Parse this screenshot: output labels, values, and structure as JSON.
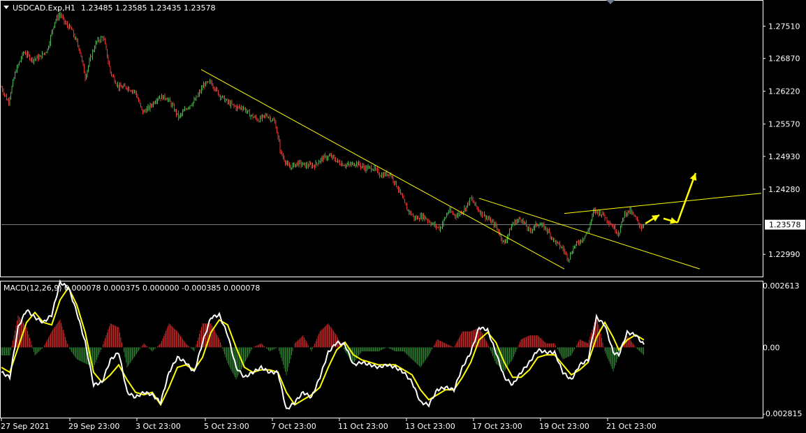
{
  "header": {
    "symbol": "USDCAD.Exp,H1",
    "ohlc": "1.23485 1.23585 1.23435 1.23578",
    "macd_label": "MACD(12,26,9)",
    "macd_values": "0.000078 0.000375 0.000000 -0.000385 0.000078"
  },
  "colors": {
    "background": "#000000",
    "frame": "#ffffff",
    "bull_candle": "#4caf50",
    "bear_candle": "#e53935",
    "trendline": "#ffff00",
    "annotation_arrow": "#ffff00",
    "macd_line": "#ffffff",
    "signal_line": "#ffff00",
    "hist_positive": "#c62828",
    "hist_negative": "#2e7d32",
    "price_line": "#b0bec5"
  },
  "current_price": "1.23578",
  "chart_data": [
    {
      "type": "candlestick",
      "title": "USDCAD.Exp,H1",
      "ylim": [
        1.2255,
        1.28
      ],
      "y_ticks": [
        "1.27510",
        "1.26870",
        "1.26220",
        "1.25570",
        "1.24930",
        "1.24280",
        "1.23578",
        "1.22990"
      ],
      "x_ticks": [
        "27 Sep 2021",
        "29 Sep 23:00",
        "3 Oct 23:00",
        "5 Oct 23:00",
        "7 Oct 23:00",
        "11 Oct 23:00",
        "13 Oct 23:00",
        "17 Oct 23:00",
        "19 Oct 23:00",
        "21 Oct 23:00"
      ],
      "price_path": [
        {
          "x": 0,
          "y": 1.263
        },
        {
          "x": 5,
          "y": 1.26
        },
        {
          "x": 10,
          "y": 1.266
        },
        {
          "x": 16,
          "y": 1.27
        },
        {
          "x": 22,
          "y": 1.2685
        },
        {
          "x": 28,
          "y": 1.269
        },
        {
          "x": 33,
          "y": 1.2705
        },
        {
          "x": 38,
          "y": 1.276
        },
        {
          "x": 42,
          "y": 1.2775
        },
        {
          "x": 46,
          "y": 1.2755
        },
        {
          "x": 50,
          "y": 1.2745
        },
        {
          "x": 56,
          "y": 1.2705
        },
        {
          "x": 60,
          "y": 1.265
        },
        {
          "x": 64,
          "y": 1.269
        },
        {
          "x": 68,
          "y": 1.272
        },
        {
          "x": 73,
          "y": 1.273
        },
        {
          "x": 78,
          "y": 1.266
        },
        {
          "x": 84,
          "y": 1.263
        },
        {
          "x": 90,
          "y": 1.263
        },
        {
          "x": 96,
          "y": 1.262
        },
        {
          "x": 101,
          "y": 1.258
        },
        {
          "x": 106,
          "y": 1.259
        },
        {
          "x": 112,
          "y": 1.261
        },
        {
          "x": 118,
          "y": 1.261
        },
        {
          "x": 122,
          "y": 1.2595
        },
        {
          "x": 127,
          "y": 1.257
        },
        {
          "x": 133,
          "y": 1.259
        },
        {
          "x": 139,
          "y": 1.2605
        },
        {
          "x": 145,
          "y": 1.2635
        },
        {
          "x": 150,
          "y": 1.264
        },
        {
          "x": 156,
          "y": 1.2615
        },
        {
          "x": 162,
          "y": 1.26
        },
        {
          "x": 168,
          "y": 1.259
        },
        {
          "x": 173,
          "y": 1.259
        },
        {
          "x": 178,
          "y": 1.2575
        },
        {
          "x": 184,
          "y": 1.2565
        },
        {
          "x": 190,
          "y": 1.2575
        },
        {
          "x": 196,
          "y": 1.256
        },
        {
          "x": 200,
          "y": 1.25
        },
        {
          "x": 206,
          "y": 1.247
        },
        {
          "x": 212,
          "y": 1.248
        },
        {
          "x": 218,
          "y": 1.2475
        },
        {
          "x": 224,
          "y": 1.2475
        },
        {
          "x": 230,
          "y": 1.249
        },
        {
          "x": 236,
          "y": 1.2493
        },
        {
          "x": 242,
          "y": 1.248
        },
        {
          "x": 248,
          "y": 1.2475
        },
        {
          "x": 254,
          "y": 1.248
        },
        {
          "x": 260,
          "y": 1.247
        },
        {
          "x": 266,
          "y": 1.247
        },
        {
          "x": 272,
          "y": 1.2455
        },
        {
          "x": 278,
          "y": 1.246
        },
        {
          "x": 284,
          "y": 1.243
        },
        {
          "x": 290,
          "y": 1.239
        },
        {
          "x": 296,
          "y": 1.237
        },
        {
          "x": 302,
          "y": 1.2375
        },
        {
          "x": 308,
          "y": 1.236
        },
        {
          "x": 314,
          "y": 1.235
        },
        {
          "x": 320,
          "y": 1.2385
        },
        {
          "x": 326,
          "y": 1.2375
        },
        {
          "x": 332,
          "y": 1.239
        },
        {
          "x": 336,
          "y": 1.241
        },
        {
          "x": 342,
          "y": 1.2385
        },
        {
          "x": 348,
          "y": 1.237
        },
        {
          "x": 354,
          "y": 1.2355
        },
        {
          "x": 360,
          "y": 1.232
        },
        {
          "x": 366,
          "y": 1.236
        },
        {
          "x": 372,
          "y": 1.237
        },
        {
          "x": 378,
          "y": 1.2345
        },
        {
          "x": 384,
          "y": 1.236
        },
        {
          "x": 390,
          "y": 1.235
        },
        {
          "x": 396,
          "y": 1.2325
        },
        {
          "x": 402,
          "y": 1.231
        },
        {
          "x": 406,
          "y": 1.229
        },
        {
          "x": 410,
          "y": 1.2315
        },
        {
          "x": 416,
          "y": 1.233
        },
        {
          "x": 420,
          "y": 1.2345
        },
        {
          "x": 424,
          "y": 1.2385
        },
        {
          "x": 430,
          "y": 1.238
        },
        {
          "x": 436,
          "y": 1.236
        },
        {
          "x": 442,
          "y": 1.234
        },
        {
          "x": 446,
          "y": 1.238
        },
        {
          "x": 450,
          "y": 1.2385
        },
        {
          "x": 454,
          "y": 1.237
        },
        {
          "x": 458,
          "y": 1.2352
        },
        {
          "x": 460,
          "y": 1.2358
        }
      ],
      "trendlines": [
        {
          "name": "main-downtrend",
          "x1": 143,
          "y1": 1.2665,
          "x2": 403,
          "y2": 1.227
        },
        {
          "name": "channel-lower",
          "x1": 342,
          "y1": 1.241,
          "x2": 500,
          "y2": 1.227
        },
        {
          "name": "channel-upper",
          "x1": 403,
          "y1": 1.238,
          "x2": 544,
          "y2": 1.242
        }
      ],
      "projection_arrows": [
        {
          "x1": 461,
          "y1": 1.236,
          "x2": 471,
          "y2": 1.2377
        },
        {
          "x1": 474,
          "y1": 1.237,
          "x2": 484,
          "y2": 1.2362
        },
        {
          "x1": 484,
          "y1": 1.2362,
          "x2": 497,
          "y2": 1.246
        }
      ]
    },
    {
      "type": "macd",
      "title": "MACD(12,26,9)",
      "ylim": [
        -0.002815,
        0.002613
      ],
      "y_ticks": [
        "0.002613",
        "0.00",
        "-0.002815"
      ],
      "macd_path": [
        {
          "x": 0,
          "y": -0.001
        },
        {
          "x": 6,
          "y": -0.0012
        },
        {
          "x": 12,
          "y": 0.0008
        },
        {
          "x": 18,
          "y": 0.0015
        },
        {
          "x": 24,
          "y": 0.0012
        },
        {
          "x": 30,
          "y": 0.001
        },
        {
          "x": 36,
          "y": 0.0013
        },
        {
          "x": 42,
          "y": 0.0026
        },
        {
          "x": 48,
          "y": 0.0024
        },
        {
          "x": 54,
          "y": 0.0014
        },
        {
          "x": 60,
          "y": 0.0002
        },
        {
          "x": 66,
          "y": -0.0015
        },
        {
          "x": 72,
          "y": -0.0014
        },
        {
          "x": 78,
          "y": -0.0005
        },
        {
          "x": 84,
          "y": -0.0002
        },
        {
          "x": 90,
          "y": -0.0018
        },
        {
          "x": 96,
          "y": -0.002
        },
        {
          "x": 102,
          "y": -0.0018
        },
        {
          "x": 108,
          "y": -0.0019
        },
        {
          "x": 114,
          "y": -0.0022
        },
        {
          "x": 120,
          "y": -0.001
        },
        {
          "x": 126,
          "y": -0.0004
        },
        {
          "x": 132,
          "y": -0.0006
        },
        {
          "x": 138,
          "y": -0.001
        },
        {
          "x": 144,
          "y": 0.0002
        },
        {
          "x": 150,
          "y": 0.0012
        },
        {
          "x": 156,
          "y": 0.0013
        },
        {
          "x": 162,
          "y": 0.0005
        },
        {
          "x": 168,
          "y": -0.0008
        },
        {
          "x": 174,
          "y": -0.0012
        },
        {
          "x": 180,
          "y": -0.001
        },
        {
          "x": 186,
          "y": -0.0008
        },
        {
          "x": 192,
          "y": -0.001
        },
        {
          "x": 198,
          "y": -0.001
        },
        {
          "x": 204,
          "y": -0.0025
        },
        {
          "x": 210,
          "y": -0.0022
        },
        {
          "x": 216,
          "y": -0.0018
        },
        {
          "x": 222,
          "y": -0.002
        },
        {
          "x": 228,
          "y": -0.0012
        },
        {
          "x": 234,
          "y": -0.0002
        },
        {
          "x": 240,
          "y": 0.0002
        },
        {
          "x": 246,
          "y": 0.0001
        },
        {
          "x": 252,
          "y": -0.0007
        },
        {
          "x": 258,
          "y": -0.0006
        },
        {
          "x": 264,
          "y": -0.0007
        },
        {
          "x": 270,
          "y": -0.0008
        },
        {
          "x": 276,
          "y": -0.0007
        },
        {
          "x": 282,
          "y": -0.0008
        },
        {
          "x": 288,
          "y": -0.001
        },
        {
          "x": 294,
          "y": -0.0014
        },
        {
          "x": 300,
          "y": -0.0022
        },
        {
          "x": 306,
          "y": -0.0023
        },
        {
          "x": 312,
          "y": -0.0017
        },
        {
          "x": 318,
          "y": -0.0016
        },
        {
          "x": 324,
          "y": -0.0017
        },
        {
          "x": 330,
          "y": -0.0008
        },
        {
          "x": 336,
          "y": -0.0002
        },
        {
          "x": 342,
          "y": 0.0008
        },
        {
          "x": 348,
          "y": 0.0007
        },
        {
          "x": 354,
          "y": -0.0002
        },
        {
          "x": 360,
          "y": -0.0012
        },
        {
          "x": 366,
          "y": -0.0015
        },
        {
          "x": 372,
          "y": -0.001
        },
        {
          "x": 378,
          "y": -0.0006
        },
        {
          "x": 384,
          "y": -0.0001
        },
        {
          "x": 390,
          "y": -0.0002
        },
        {
          "x": 396,
          "y": -0.0002
        },
        {
          "x": 402,
          "y": -0.001
        },
        {
          "x": 408,
          "y": -0.0013
        },
        {
          "x": 414,
          "y": -0.0007
        },
        {
          "x": 420,
          "y": -0.0005
        },
        {
          "x": 426,
          "y": 0.0012
        },
        {
          "x": 432,
          "y": 0.0009
        },
        {
          "x": 438,
          "y": -0.0002
        },
        {
          "x": 442,
          "y": -0.0003
        },
        {
          "x": 448,
          "y": 0.0006
        },
        {
          "x": 454,
          "y": 0.0005
        },
        {
          "x": 460,
          "y": 0.0001
        }
      ],
      "signal_path": [
        {
          "x": 0,
          "y": -0.0008
        },
        {
          "x": 6,
          "y": -0.001
        },
        {
          "x": 12,
          "y": 0.0
        },
        {
          "x": 18,
          "y": 0.001
        },
        {
          "x": 24,
          "y": 0.0014
        },
        {
          "x": 30,
          "y": 0.001
        },
        {
          "x": 36,
          "y": 0.0009
        },
        {
          "x": 42,
          "y": 0.0019
        },
        {
          "x": 48,
          "y": 0.0024
        },
        {
          "x": 54,
          "y": 0.0017
        },
        {
          "x": 60,
          "y": 0.0006
        },
        {
          "x": 66,
          "y": -0.001
        },
        {
          "x": 72,
          "y": -0.0014
        },
        {
          "x": 78,
          "y": -0.0011
        },
        {
          "x": 84,
          "y": -0.0007
        },
        {
          "x": 90,
          "y": -0.0013
        },
        {
          "x": 96,
          "y": -0.0018
        },
        {
          "x": 102,
          "y": -0.0019
        },
        {
          "x": 108,
          "y": -0.0018
        },
        {
          "x": 114,
          "y": -0.0023
        },
        {
          "x": 120,
          "y": -0.0016
        },
        {
          "x": 126,
          "y": -0.0008
        },
        {
          "x": 132,
          "y": -0.0007
        },
        {
          "x": 138,
          "y": -0.0009
        },
        {
          "x": 144,
          "y": -0.0004
        },
        {
          "x": 150,
          "y": 0.0006
        },
        {
          "x": 156,
          "y": 0.0011
        },
        {
          "x": 162,
          "y": 0.0009
        },
        {
          "x": 168,
          "y": 0.0
        },
        {
          "x": 174,
          "y": -0.0008
        },
        {
          "x": 180,
          "y": -0.001
        },
        {
          "x": 186,
          "y": -0.0009
        },
        {
          "x": 192,
          "y": -0.0009
        },
        {
          "x": 198,
          "y": -0.001
        },
        {
          "x": 204,
          "y": -0.0018
        },
        {
          "x": 210,
          "y": -0.0023
        },
        {
          "x": 216,
          "y": -0.0021
        },
        {
          "x": 222,
          "y": -0.0019
        },
        {
          "x": 228,
          "y": -0.0016
        },
        {
          "x": 234,
          "y": -0.0008
        },
        {
          "x": 240,
          "y": -0.0001
        },
        {
          "x": 246,
          "y": 0.0002
        },
        {
          "x": 252,
          "y": -0.0003
        },
        {
          "x": 258,
          "y": -0.0005
        },
        {
          "x": 264,
          "y": -0.0006
        },
        {
          "x": 270,
          "y": -0.0007
        },
        {
          "x": 276,
          "y": -0.0007
        },
        {
          "x": 282,
          "y": -0.0007
        },
        {
          "x": 288,
          "y": -0.0009
        },
        {
          "x": 294,
          "y": -0.0011
        },
        {
          "x": 300,
          "y": -0.0017
        },
        {
          "x": 306,
          "y": -0.0021
        },
        {
          "x": 312,
          "y": -0.0019
        },
        {
          "x": 318,
          "y": -0.0017
        },
        {
          "x": 324,
          "y": -0.0017
        },
        {
          "x": 330,
          "y": -0.0012
        },
        {
          "x": 336,
          "y": -0.0006
        },
        {
          "x": 342,
          "y": 0.0003
        },
        {
          "x": 348,
          "y": 0.0006
        },
        {
          "x": 354,
          "y": 0.0002
        },
        {
          "x": 360,
          "y": -0.0006
        },
        {
          "x": 366,
          "y": -0.0012
        },
        {
          "x": 372,
          "y": -0.0012
        },
        {
          "x": 378,
          "y": -0.0009
        },
        {
          "x": 384,
          "y": -0.0004
        },
        {
          "x": 390,
          "y": -0.0003
        },
        {
          "x": 396,
          "y": -0.0003
        },
        {
          "x": 402,
          "y": -0.0007
        },
        {
          "x": 408,
          "y": -0.0011
        },
        {
          "x": 414,
          "y": -0.0009
        },
        {
          "x": 420,
          "y": -0.0006
        },
        {
          "x": 426,
          "y": 0.0004
        },
        {
          "x": 432,
          "y": 0.001
        },
        {
          "x": 438,
          "y": 0.0004
        },
        {
          "x": 442,
          "y": -0.0001
        },
        {
          "x": 448,
          "y": 0.0003
        },
        {
          "x": 454,
          "y": 0.0005
        },
        {
          "x": 460,
          "y": 0.0003
        }
      ]
    }
  ]
}
